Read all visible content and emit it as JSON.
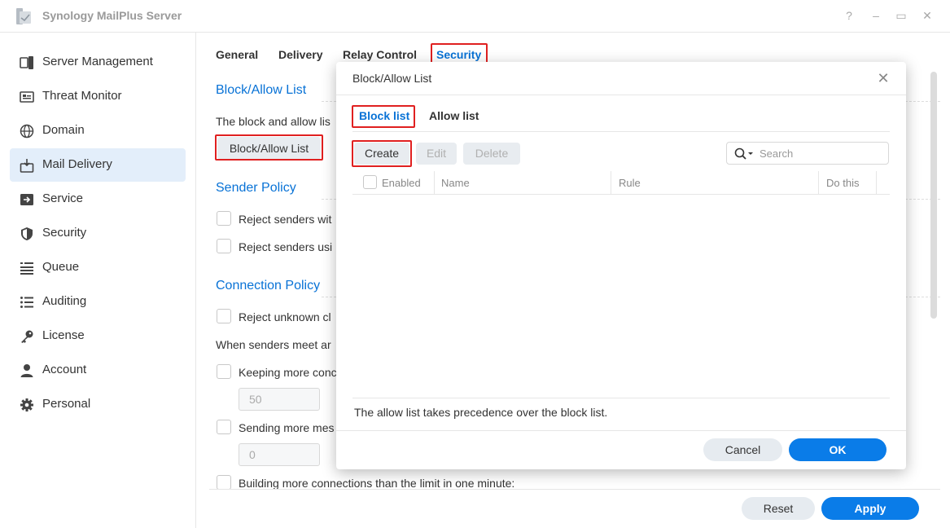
{
  "app": {
    "title": "Synology MailPlus Server",
    "window_buttons": [
      "?",
      "–",
      "▭",
      "✕"
    ]
  },
  "sidebar": {
    "items": [
      {
        "label": "Server Management",
        "icon": "server-icon",
        "active": false
      },
      {
        "label": "Threat Monitor",
        "icon": "monitor-icon",
        "active": false
      },
      {
        "label": "Domain",
        "icon": "globe-icon",
        "active": false
      },
      {
        "label": "Mail Delivery",
        "icon": "mail-delivery-icon",
        "active": true
      },
      {
        "label": "Service",
        "icon": "service-icon",
        "active": false
      },
      {
        "label": "Security",
        "icon": "shield-icon",
        "active": false
      },
      {
        "label": "Queue",
        "icon": "queue-icon",
        "active": false
      },
      {
        "label": "Auditing",
        "icon": "list-icon",
        "active": false
      },
      {
        "label": "License",
        "icon": "key-icon",
        "active": false
      },
      {
        "label": "Account",
        "icon": "user-icon",
        "active": false
      },
      {
        "label": "Personal",
        "icon": "gear-icon",
        "active": false
      }
    ]
  },
  "main": {
    "tabs": [
      "General",
      "Delivery",
      "Relay Control",
      "Security"
    ],
    "active_tab": "Security",
    "block_allow": {
      "title": "Block/Allow List",
      "desc": "The block and allow lis",
      "button": "Block/Allow List"
    },
    "sender_policy": {
      "title": "Sender Policy",
      "options": [
        "Reject senders wit",
        "Reject senders usi"
      ]
    },
    "connection_policy": {
      "title": "Connection Policy",
      "option_reject": "Reject unknown cl",
      "when_text": "When senders meet ar",
      "keeping": "Keeping more conc",
      "keeping_value": "50",
      "sending": "Sending more mes",
      "sending_value": "0",
      "building": "Building more connections than the limit in one minute:"
    },
    "footer": {
      "reset": "Reset",
      "apply": "Apply"
    }
  },
  "modal": {
    "title": "Block/Allow List",
    "tabs": [
      "Block list",
      "Allow list"
    ],
    "toolbar": {
      "create": "Create",
      "edit": "Edit",
      "delete": "Delete"
    },
    "search_placeholder": "Search",
    "columns": [
      "Enabled",
      "Name",
      "Rule",
      "Do this"
    ],
    "note": "The allow list takes precedence over the block list.",
    "cancel": "Cancel",
    "ok": "OK"
  },
  "colors": {
    "accent": "#0872d6",
    "primary_button": "#0a7ce8",
    "highlight": "#e02020",
    "active_sidebar": "#e3eefa"
  }
}
